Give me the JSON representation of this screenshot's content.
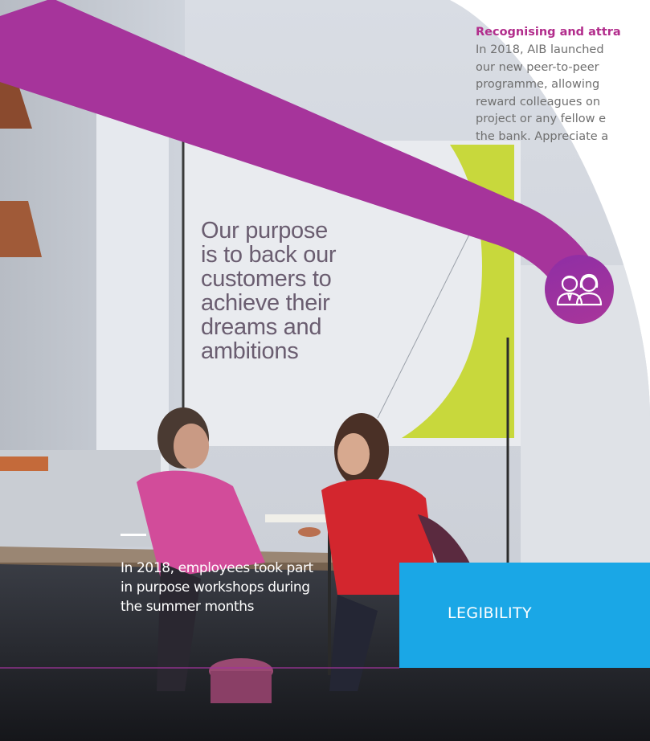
{
  "article": {
    "heading": "Recognising and attra",
    "body_lines": [
      "In 2018, AIB launched",
      "our new peer-to-peer",
      "programme, allowing",
      "reward colleagues on",
      "project or any fellow e",
      "the bank. Appreciate a"
    ]
  },
  "photo": {
    "wall_text_lines": [
      "Our purpose",
      "is to back our",
      "customers to",
      "achieve their",
      "dreams and",
      "ambitions"
    ]
  },
  "caption": {
    "lines": [
      "In 2018, employees took part",
      "in purpose workshops during",
      "the summer months"
    ]
  },
  "legibility_box": {
    "label": "LEGIBILITY"
  },
  "icons": {
    "people": "two-people-icon"
  },
  "colors": {
    "magenta": "#b22d8c",
    "purple_band": "#a0339b",
    "cyan": "#1aa7e6",
    "lime": "#c8d83c"
  }
}
